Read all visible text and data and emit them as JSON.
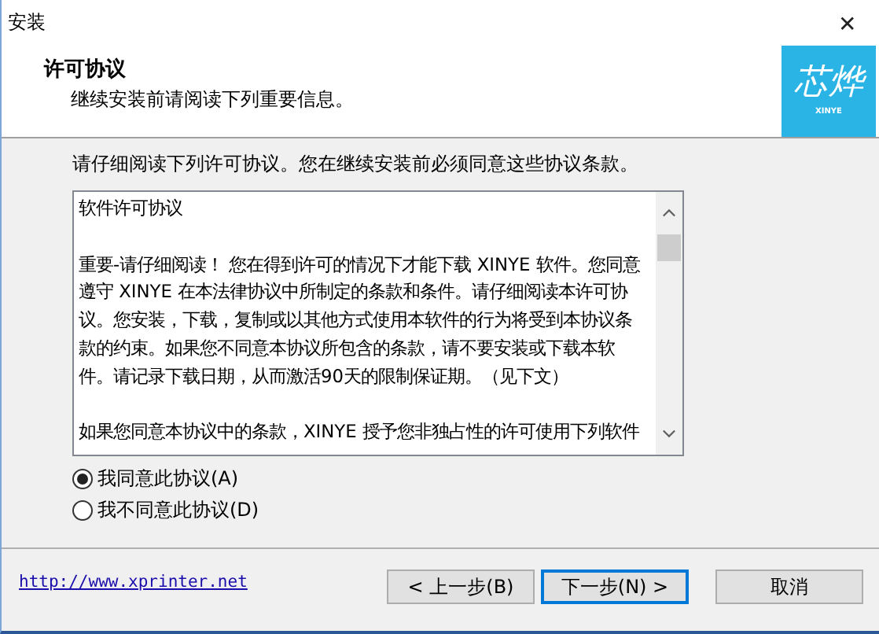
{
  "window": {
    "title": "安装",
    "close": "✕"
  },
  "header": {
    "title": "许可协议",
    "subtitle": "继续安装前请阅读下列重要信息。",
    "logo": {
      "name": "芯烨",
      "tagline": "XINYE"
    }
  },
  "instruction": "请仔细阅读下列许可协议。您在继续安装前必须同意这些协议条款。",
  "license": {
    "paragraphs": [
      [
        "软件许可协议"
      ],
      [
        "重要-请仔细阅读！  您在得到许可的情况下才能下载 XINYE 软件。您同意",
        "遵守 XINYE 在本法律协议中所制定的条款和条件。请仔细阅读本许可协",
        "议。您安装，下载，复制或以其他方式使用本软件的行为将受到本协议条",
        "款的约束。如果您不同意本协议所包含的条款，请不要安装或下载本软",
        "件。请记录下载日期，从而激活90天的限制保证期。（见下文）"
      ],
      [
        "如果您同意本协议中的条款，XINYE 授予您非独占性的许可使用下列软件"
      ]
    ]
  },
  "options": [
    {
      "label": "我同意此协议(A)",
      "selected": true
    },
    {
      "label": "我不同意此协议(D)",
      "selected": false
    }
  ],
  "link": "http://www.xprinter.net",
  "buttons": [
    {
      "label": "< 上一步(B)",
      "default": false
    },
    {
      "label": "下一步(N) >",
      "default": true
    },
    {
      "label": "取消",
      "default": false
    }
  ]
}
